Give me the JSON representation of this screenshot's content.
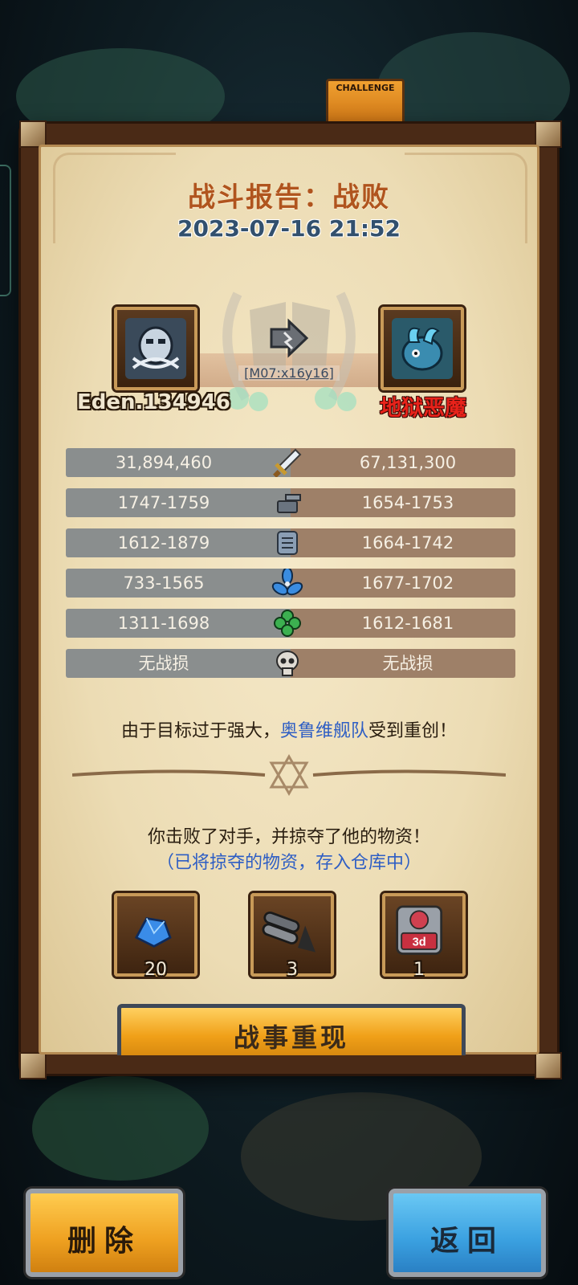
{
  "background": {
    "challenge_label": "CHALLENGE"
  },
  "report": {
    "title": "战斗报告：战败",
    "datetime": "2023-07-16 21:52",
    "coordinate": "[M07:x16y16]",
    "attacker_name": "Eden.134946",
    "defender_name": "地狱恶魔"
  },
  "stats": [
    {
      "icon": "sword-icon",
      "left": "31,894,460",
      "right": "67,131,300"
    },
    {
      "icon": "cannon-icon",
      "left": "1747-1759",
      "right": "1654-1753"
    },
    {
      "icon": "armor-icon",
      "left": "1612-1879",
      "right": "1664-1742"
    },
    {
      "icon": "propeller-icon",
      "left": "733-1565",
      "right": "1677-1702"
    },
    {
      "icon": "clover-icon",
      "left": "1311-1698",
      "right": "1612-1681"
    },
    {
      "icon": "skull-icon",
      "left": "无战损",
      "right": "无战损"
    }
  ],
  "messages": {
    "line1_prefix": "由于目标过于强大，",
    "line1_highlight": "奥鲁维舰队",
    "line1_suffix": "受到重创！",
    "line2": "你击败了对手，并掠夺了他的物资！",
    "line3": "（已将掠夺的物资，存入仓库中）"
  },
  "loot": [
    {
      "icon": "blue-crystal-icon",
      "count": "20"
    },
    {
      "icon": "cannon-barrel-icon",
      "count": "3"
    },
    {
      "icon": "speedup-3d-icon",
      "count": "1",
      "badge": "3d"
    }
  ],
  "buttons": {
    "replay": "战事重现",
    "delete": "删除",
    "back": "返回"
  },
  "colors": {
    "title": "#b0541e",
    "defender_name": "#e8221a",
    "highlight": "#2e5ec4",
    "stat_left_bg": "#8a8e8e",
    "stat_right_bg": "#9e8068"
  }
}
